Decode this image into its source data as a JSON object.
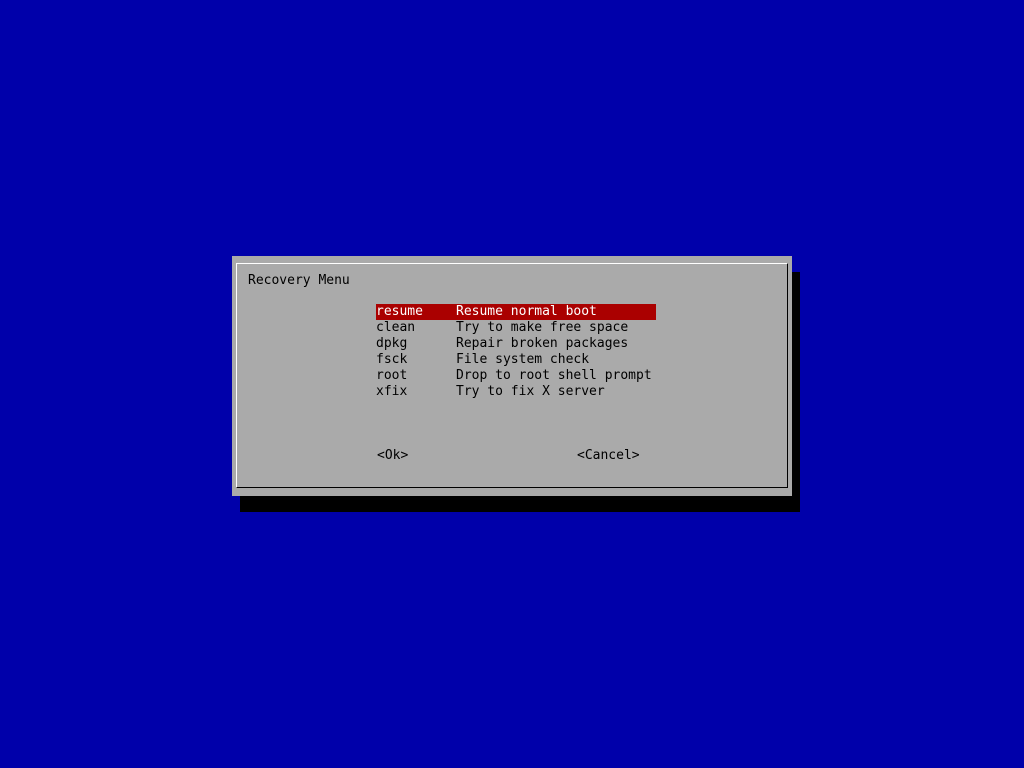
{
  "dialog": {
    "title": "Recovery Menu"
  },
  "menu": {
    "items": [
      {
        "tag": "resume",
        "description": "Resume normal boot",
        "selected": true
      },
      {
        "tag": "clean",
        "description": "Try to make free space",
        "selected": false
      },
      {
        "tag": "dpkg",
        "description": "Repair broken packages",
        "selected": false
      },
      {
        "tag": "fsck",
        "description": "File system check",
        "selected": false
      },
      {
        "tag": "root",
        "description": "Drop to root shell prompt",
        "selected": false
      },
      {
        "tag": "xfix",
        "description": "Try to fix X server",
        "selected": false
      }
    ]
  },
  "buttons": {
    "ok_label": "<Ok>",
    "cancel_label": "<Cancel>"
  },
  "colors": {
    "background": "#0000aa",
    "dialog": "#aaaaaa",
    "highlight": "#aa0000",
    "highlight_text": "#ffffff",
    "shadow": "#000000"
  }
}
